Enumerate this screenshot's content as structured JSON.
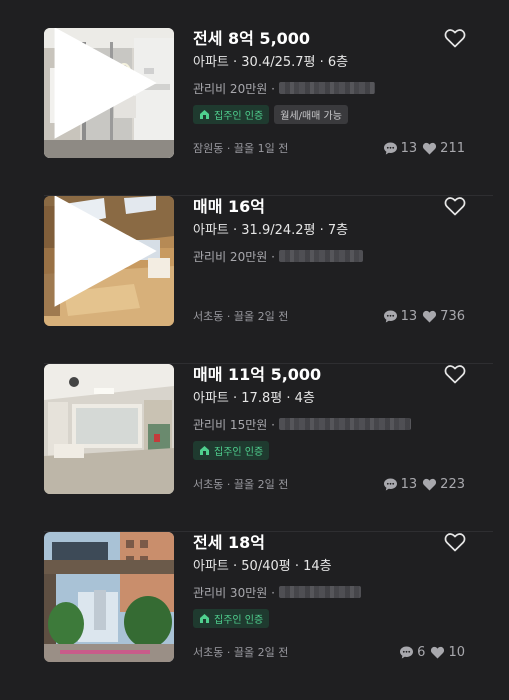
{
  "colors": {
    "background": "#1f1f21",
    "verify_green": "#4fcf8e"
  },
  "icons": {
    "favorite": "heart-outline-icon",
    "video": "play-icon",
    "verify": "home-icon",
    "comment": "speech-bubble-icon",
    "like": "heart-filled-icon"
  },
  "listings": [
    {
      "price": "전세 8억 5,000",
      "spec": "아파트 · 30.4/25.7평 · 6층",
      "fee": "관리비 20만원 ·",
      "tags": [
        "집주인 인증",
        "월세/매매 가능"
      ],
      "meta": "잠원동 · 끌올 1일 전",
      "comments": "13",
      "likes": "211"
    },
    {
      "price": "매매 16억",
      "spec": "아파트 · 31.9/24.2평 · 7층",
      "fee": "관리비 20만원 ·",
      "tags": [],
      "meta": "서초동 · 끌올 2일 전",
      "comments": "13",
      "likes": "736"
    },
    {
      "price": "매매 11억 5,000",
      "spec": "아파트 · 17.8평 · 4층",
      "fee": "관리비 15만원 ·",
      "tags": [
        "집주인 인증"
      ],
      "meta": "서초동 · 끌올 2일 전",
      "comments": "13",
      "likes": "223"
    },
    {
      "price": "전세 18억",
      "spec": "아파트 · 50/40평 · 14층",
      "fee": "관리비 30만원 ·",
      "tags": [
        "집주인 인증"
      ],
      "meta": "서초동 · 끌올 2일 전",
      "comments": "6",
      "likes": "10"
    }
  ]
}
